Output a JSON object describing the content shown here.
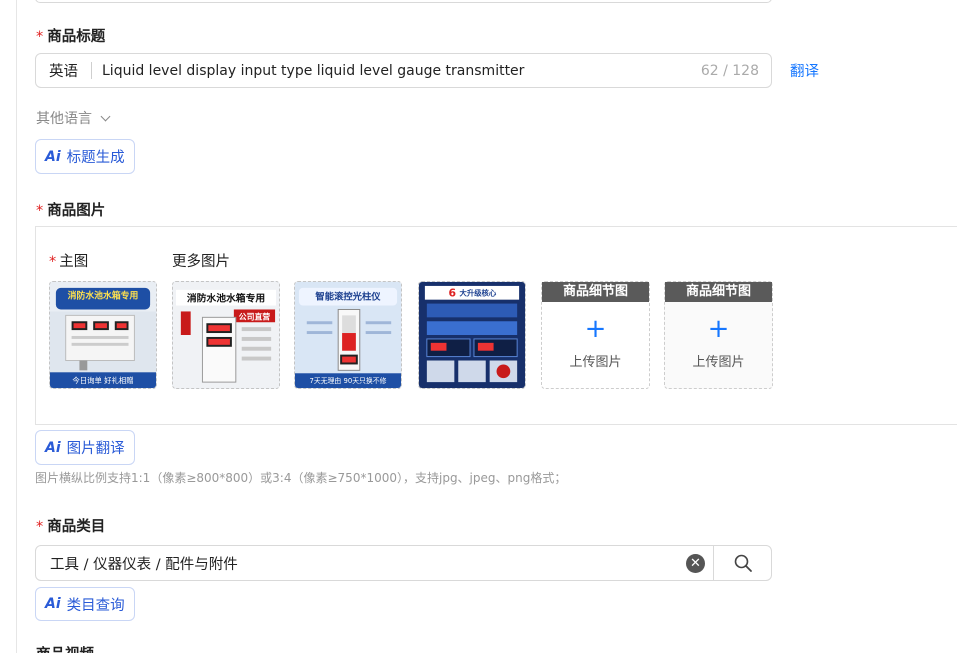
{
  "title_section": {
    "label": "商品标题",
    "language": "英语",
    "value": "Liquid level display input type liquid level gauge transmitter",
    "counter": "62 / 128",
    "translate_link": "翻译",
    "other_languages": "其他语言",
    "ai_button": "标题生成"
  },
  "image_section": {
    "label": "商品图片",
    "main_image_label": "主图",
    "more_images_label": "更多图片",
    "thumbnails": [
      {
        "banner": "消防水池水箱专用",
        "footer": "今日询单  好礼相赠"
      },
      {
        "banner": "消防水池水箱专用",
        "tag": "公司直营"
      },
      {
        "banner": "智能滚控光柱仪",
        "footer": "7天无理由 90天只换不修"
      },
      {
        "banner": "大升级核心",
        "banner_number": "6"
      }
    ],
    "upload_slots": [
      {
        "header": "商品细节图",
        "text": "上传图片"
      },
      {
        "header": "商品细节图",
        "text": "上传图片"
      }
    ],
    "ai_button": "图片翻译",
    "hint": "图片横纵比例支持1:1（像素≥800*800）或3:4（像素≥750*1000），支持jpg、jpeg、png格式；"
  },
  "category_section": {
    "label": "商品类目",
    "value": "工具 / 仪器仪表 / 配件与附件",
    "ai_button": "类目查询"
  },
  "video_section": {
    "label": "商品视频"
  },
  "colors": {
    "accent": "#1677ff",
    "required": "#e02020"
  }
}
